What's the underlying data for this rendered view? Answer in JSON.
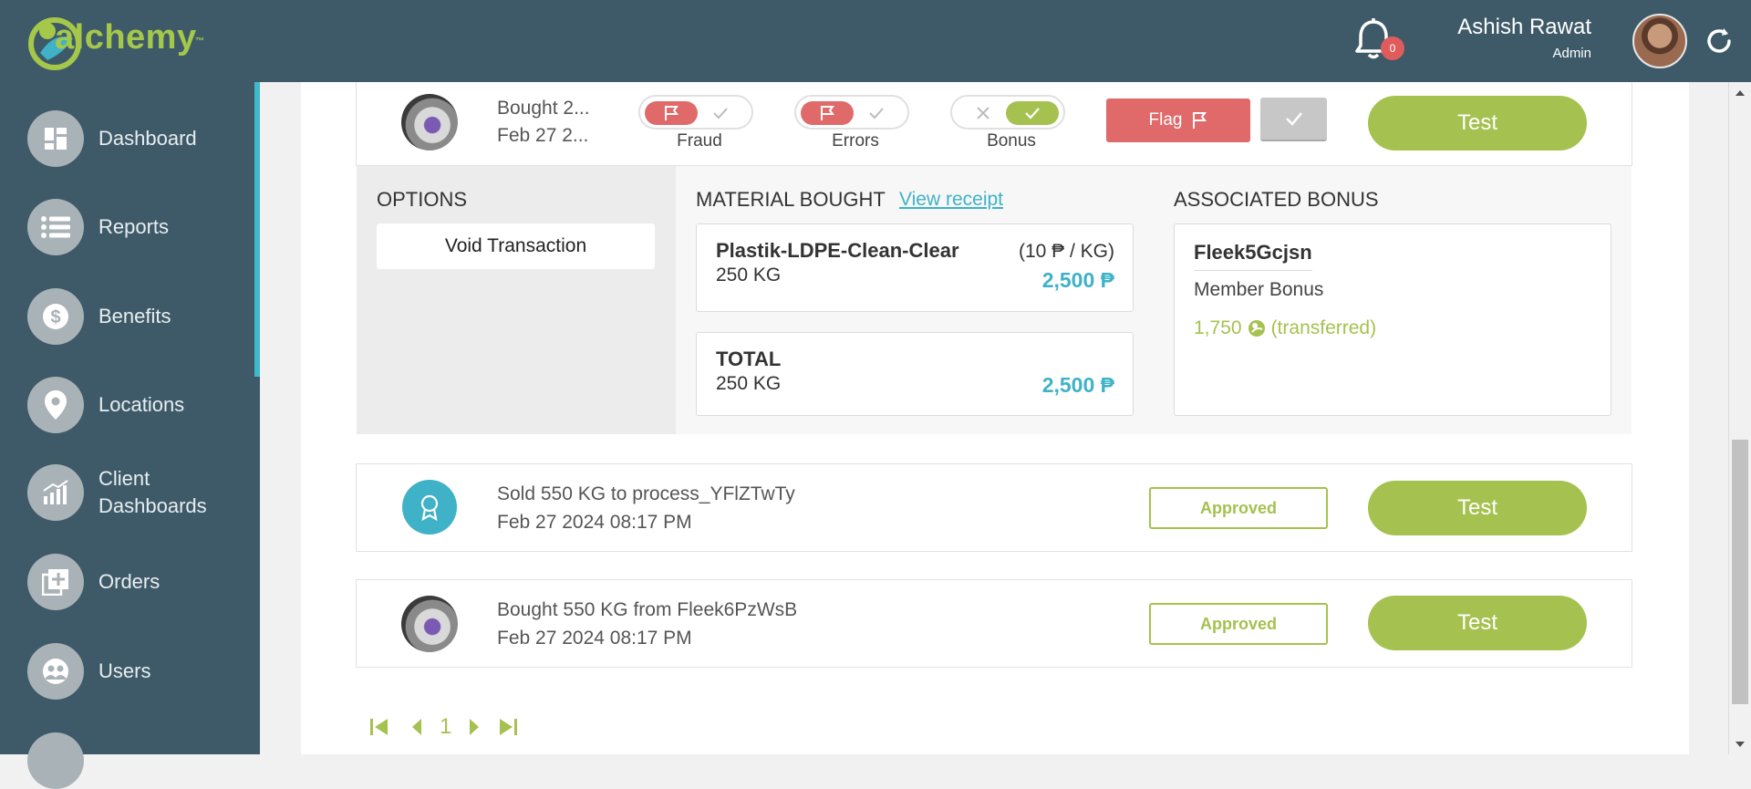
{
  "header": {
    "brand": "alchemy",
    "trademark": "™",
    "notification_count": "0",
    "user_name": "Ashish Rawat",
    "user_role": "Admin"
  },
  "sidebar": {
    "items": [
      {
        "label": "Dashboard",
        "icon": "dashboard-icon"
      },
      {
        "label": "Reports",
        "icon": "list-icon"
      },
      {
        "label": "Benefits",
        "icon": "dollar-icon"
      },
      {
        "label": "Locations",
        "icon": "location-pin-icon"
      },
      {
        "label": "Client Dashboards",
        "icon": "chart-icon"
      },
      {
        "label": "Orders",
        "icon": "add-box-icon"
      },
      {
        "label": "Users",
        "icon": "users-icon"
      }
    ]
  },
  "transaction_expanded": {
    "line1": "Bought 2...",
    "line2": "Feb 27 2...",
    "toggles": [
      {
        "label": "Fraud",
        "state": "flagged"
      },
      {
        "label": "Errors",
        "state": "flagged"
      },
      {
        "label": "Bonus",
        "state": "checked"
      }
    ],
    "flag_label": "Flag",
    "test_label": "Test",
    "options_title": "OPTIONS",
    "void_label": "Void Transaction",
    "material_title": "MATERIAL BOUGHT",
    "view_receipt": "View receipt",
    "material": {
      "name": "Plastik-LDPE-Clean-Clear",
      "qty": "250 KG",
      "rate": "(10 ₱ / KG)",
      "amount": "2,500 ₱"
    },
    "total": {
      "label": "TOTAL",
      "qty": "250 KG",
      "amount": "2,500 ₱"
    },
    "bonus_title": "ASSOCIATED BONUS",
    "bonus": {
      "code": "Fleek5Gcjsn",
      "type": "Member Bonus",
      "amount": "1,750",
      "status": "(transferred)"
    }
  },
  "transactions": [
    {
      "line1": "Sold 550 KG to process_YFlZTwTy",
      "line2": "Feb 27 2024 08:17 PM",
      "status": "Approved",
      "test_label": "Test"
    },
    {
      "line1": "Bought 550 KG from Fleek6PzWsB",
      "line2": "Feb 27 2024 08:17 PM",
      "status": "Approved",
      "test_label": "Test"
    }
  ],
  "pagination": {
    "current_page": "1"
  },
  "colors": {
    "header_bg": "#3e5a68",
    "accent_green": "#a5c14f",
    "accent_teal": "#3fb2c7",
    "flag_red": "#e06a6a"
  }
}
